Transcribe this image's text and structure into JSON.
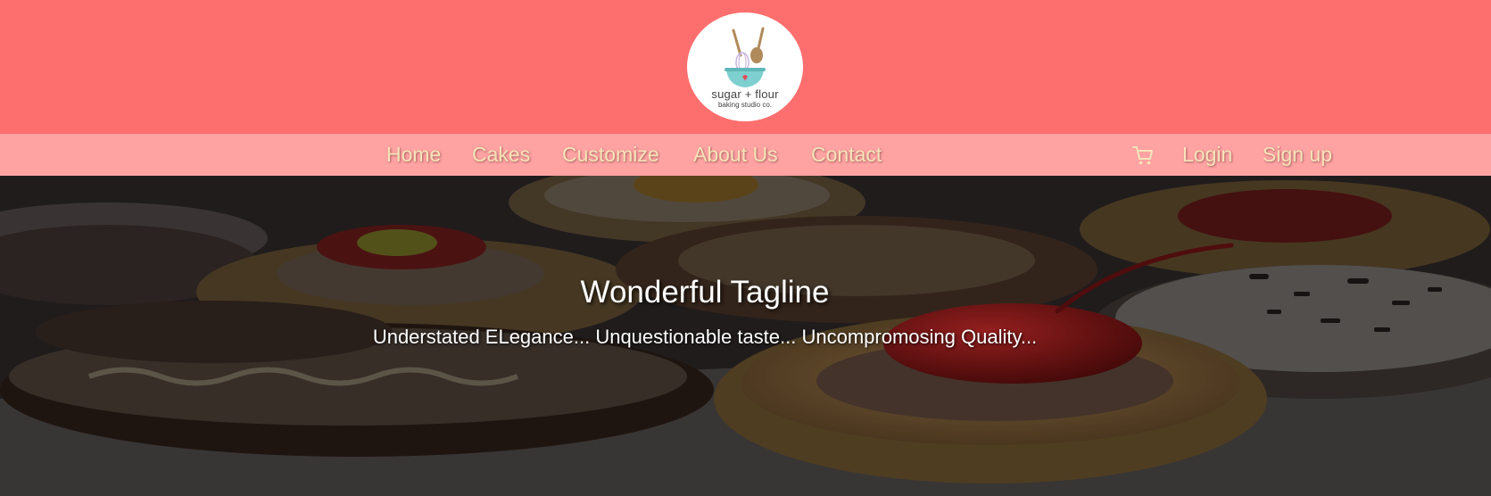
{
  "brand": {
    "logo_line1": "sugar + flour",
    "logo_line2": "baking studio co.",
    "header_color": "#fd6f6e",
    "nav_color": "#fea2a2",
    "nav_text_color": "#f6e4b9"
  },
  "nav": {
    "items": [
      {
        "label": "Home"
      },
      {
        "label": "Cakes"
      },
      {
        "label": "Customize"
      },
      {
        "label": "About Us"
      },
      {
        "label": "Contact"
      }
    ],
    "cart_icon": "shopping-cart-icon",
    "login_label": "Login",
    "signup_label": "Sign up"
  },
  "hero": {
    "title": "Wonderful Tagline",
    "subtitle": "Understated ELegance... Unquestionable taste... Uncompromosing Quality..."
  }
}
